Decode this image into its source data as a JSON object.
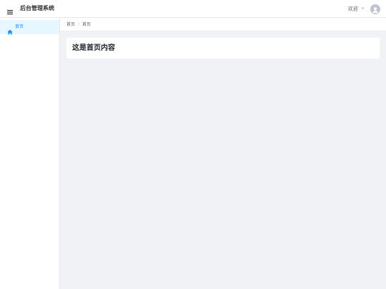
{
  "header": {
    "menu_icon": "hamburger-menu-icon",
    "title": "后台管理系统",
    "user_greeting": "欢迎",
    "user_dropdown_icon": "chevron-down-icon",
    "avatar_icon": "user-avatar-icon"
  },
  "sidebar": {
    "items": [
      {
        "label": "首页",
        "icon": "home-icon",
        "active": true
      }
    ],
    "active_color": "#1890ff",
    "active_bg": "#e6f7ff"
  },
  "breadcrumb": {
    "items": [
      "首页",
      "首页"
    ],
    "separator": "/"
  },
  "main": {
    "heading": "这是首页内容"
  },
  "colors": {
    "page_bg": "#f0f2f5",
    "header_bg": "#ffffff",
    "accent": "#1890ff",
    "avatar_bg": "#c0c4cc"
  }
}
